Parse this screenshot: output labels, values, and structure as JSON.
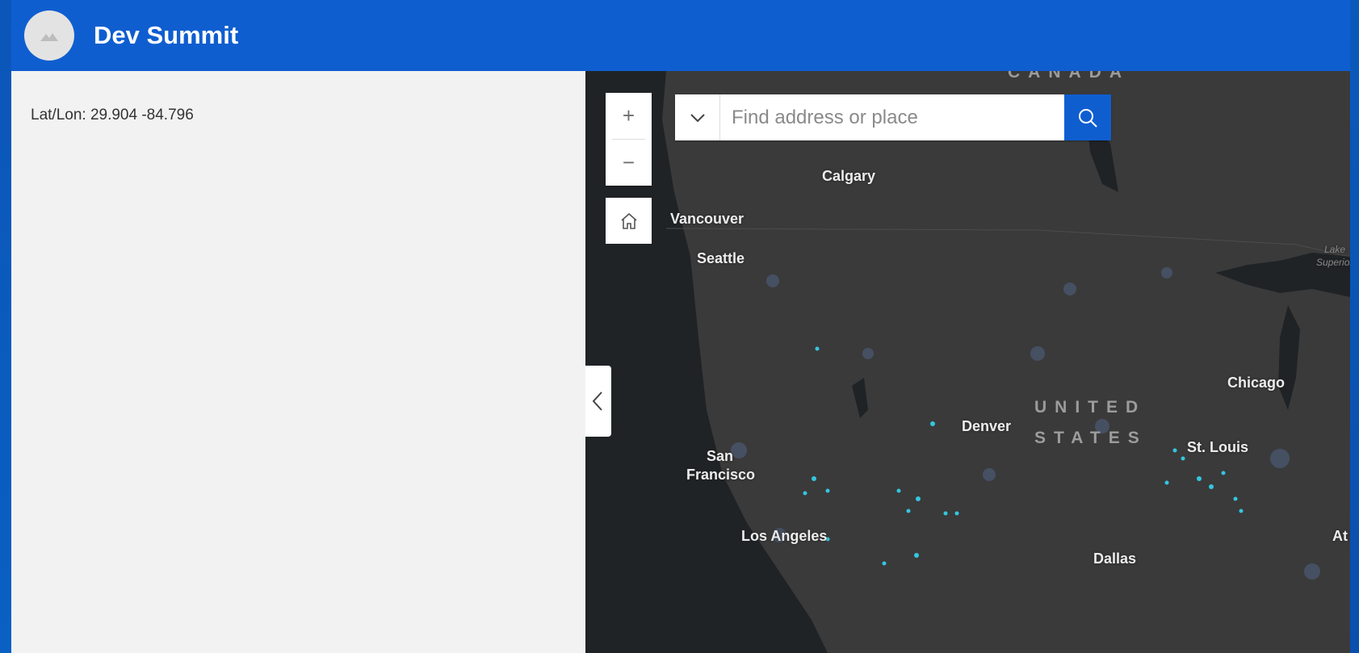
{
  "header": {
    "title": "Dev Summit"
  },
  "panel": {
    "coords_text": "Lat/Lon: 29.904 -84.796"
  },
  "search": {
    "placeholder": "Find address or place"
  },
  "map": {
    "zoom_in": "+",
    "zoom_out": "−",
    "country_labels": {
      "canada": "CANADA",
      "united": "UNITED",
      "states": "STATES"
    },
    "cities": {
      "calgary": "Calgary",
      "vancouver": "Vancouver",
      "seattle": "Seattle",
      "denver": "Denver",
      "san": "San",
      "francisco": "Francisco",
      "los_angeles": "Los Angeles",
      "chicago": "Chicago",
      "st_louis": "St. Louis",
      "dallas": "Dallas",
      "atl_partial": "At"
    },
    "lake_labels": {
      "lake": "Lake",
      "superior": "Superior"
    }
  },
  "colors": {
    "header": "#0f5ed0",
    "map_bg": "#3a3a3a",
    "water": "#1f2326",
    "points": "#34c6e0"
  }
}
